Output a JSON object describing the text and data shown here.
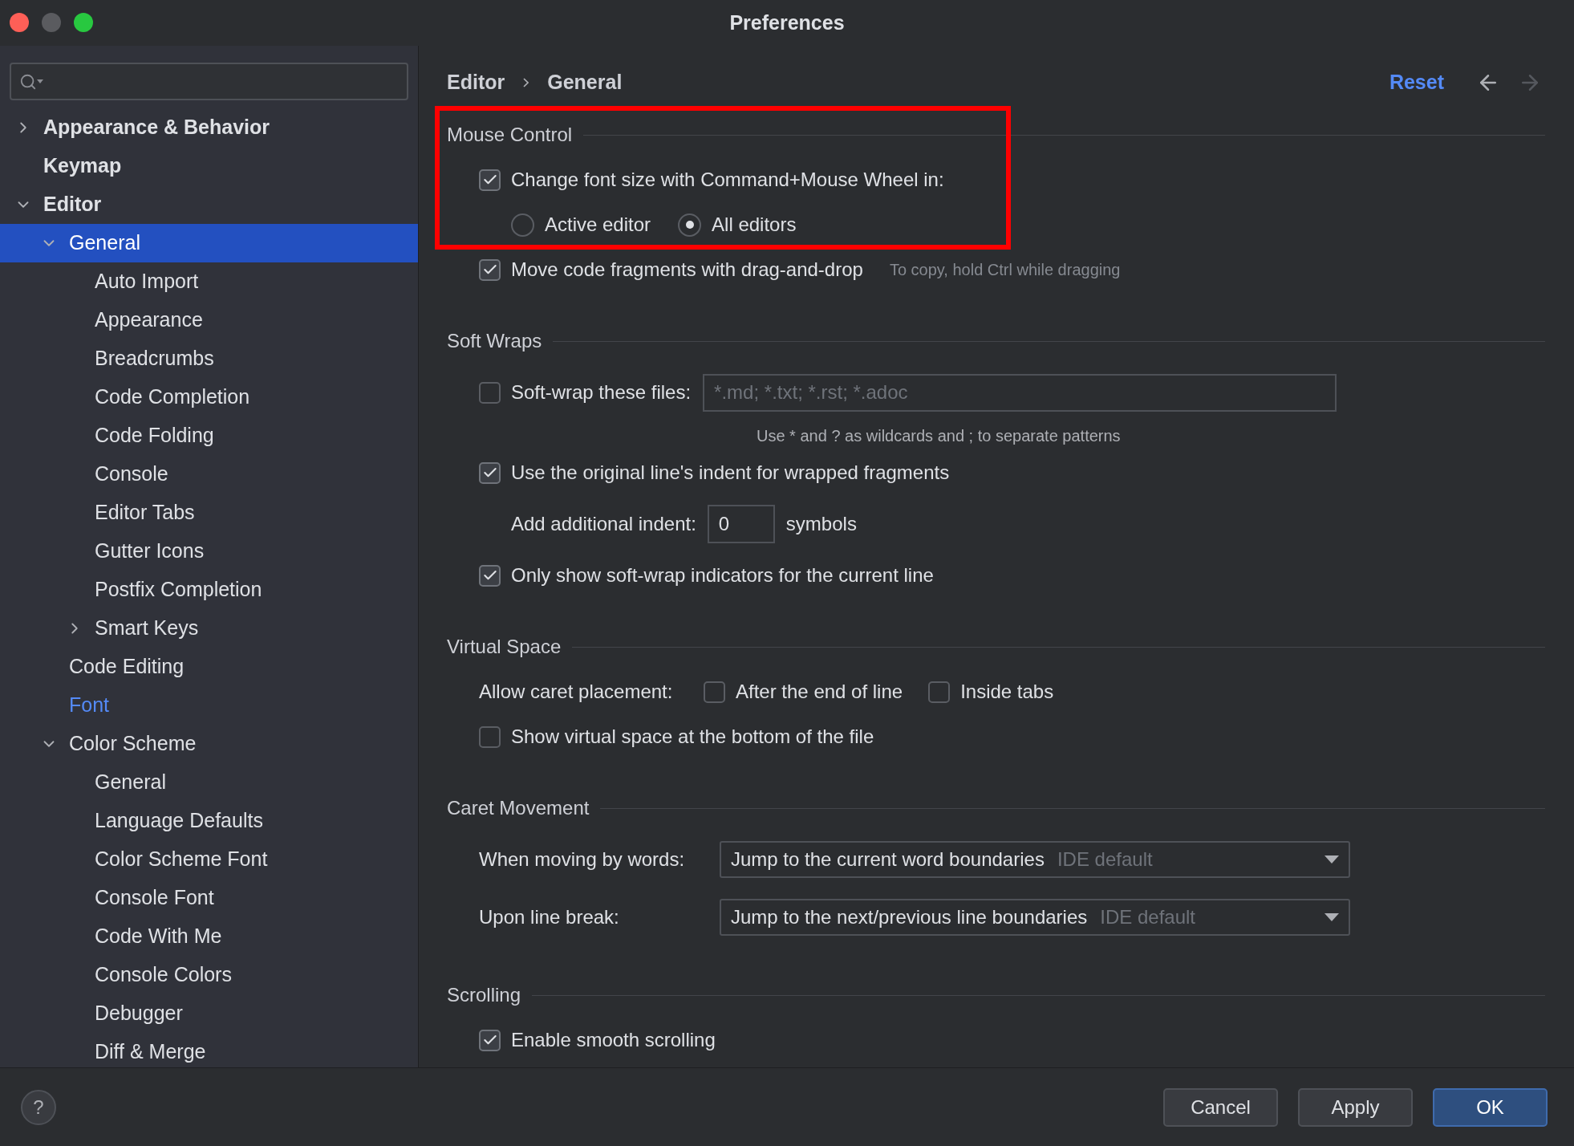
{
  "window": {
    "title": "Preferences"
  },
  "sidebar": {
    "items": [
      {
        "label": "Appearance & Behavior",
        "expanded": false,
        "selected": false,
        "modified": false
      },
      {
        "label": "Keymap",
        "selected": false,
        "modified": false
      },
      {
        "label": "Editor",
        "expanded": true,
        "selected": false,
        "modified": false,
        "children": [
          {
            "label": "General",
            "expanded": true,
            "selected": true,
            "modified": false,
            "children": [
              {
                "label": "Auto Import",
                "selected": false,
                "modified": false
              },
              {
                "label": "Appearance",
                "selected": false,
                "modified": false
              },
              {
                "label": "Breadcrumbs",
                "selected": false,
                "modified": false
              },
              {
                "label": "Code Completion",
                "selected": false,
                "modified": false
              },
              {
                "label": "Code Folding",
                "selected": false,
                "modified": false
              },
              {
                "label": "Console",
                "selected": false,
                "modified": false
              },
              {
                "label": "Editor Tabs",
                "selected": false,
                "modified": false
              },
              {
                "label": "Gutter Icons",
                "selected": false,
                "modified": false
              },
              {
                "label": "Postfix Completion",
                "selected": false,
                "modified": false
              },
              {
                "label": "Smart Keys",
                "expanded": false,
                "selected": false,
                "modified": false
              }
            ]
          },
          {
            "label": "Code Editing",
            "selected": false,
            "modified": false
          },
          {
            "label": "Font",
            "selected": false,
            "modified": true
          },
          {
            "label": "Color Scheme",
            "expanded": true,
            "selected": false,
            "modified": false,
            "children": [
              {
                "label": "General",
                "selected": false,
                "modified": false
              },
              {
                "label": "Language Defaults",
                "selected": false,
                "modified": false
              },
              {
                "label": "Color Scheme Font",
                "selected": false,
                "modified": false
              },
              {
                "label": "Console Font",
                "selected": false,
                "modified": false
              },
              {
                "label": "Code With Me",
                "selected": false,
                "modified": false
              },
              {
                "label": "Console Colors",
                "selected": false,
                "modified": false
              },
              {
                "label": "Debugger",
                "selected": false,
                "modified": false
              },
              {
                "label": "Diff & Merge",
                "selected": false,
                "modified": false
              }
            ]
          }
        ]
      }
    ]
  },
  "breadcrumb": [
    "Editor",
    "General"
  ],
  "reset": "Reset",
  "nav": {
    "back_enabled": true,
    "forward_enabled": false
  },
  "sections": [
    {
      "title": "Mouse Control",
      "highlighted": true,
      "rows": [
        {
          "kind": "checkbox",
          "label": "Change font size with Command+Mouse Wheel in:",
          "checked": true
        },
        {
          "kind": "radio_group",
          "options": [
            {
              "label": "Active editor",
              "selected": false
            },
            {
              "label": "All editors",
              "selected": true
            }
          ]
        },
        {
          "kind": "checkbox",
          "label": "Move code fragments with drag-and-drop",
          "checked": true,
          "note": "To copy, hold Ctrl while dragging"
        }
      ]
    },
    {
      "title": "Soft Wraps",
      "rows": [
        {
          "kind": "checkbox_field",
          "label": "Soft-wrap these files:",
          "checked": false,
          "placeholder": "*.md; *.txt; *.rst; *.adoc"
        },
        {
          "kind": "hint",
          "text": "Use * and ? as wildcards and ; to separate patterns"
        },
        {
          "kind": "checkbox",
          "label": "Use the original line's indent for wrapped fragments",
          "checked": true
        },
        {
          "kind": "number",
          "label": "Add additional indent:",
          "value": "0",
          "unit": "symbols"
        },
        {
          "kind": "checkbox",
          "label": "Only show soft-wrap indicators for the current line",
          "checked": true
        }
      ]
    },
    {
      "title": "Virtual Space",
      "rows": [
        {
          "kind": "inline_checks",
          "label": "Allow caret placement:",
          "options": [
            {
              "label": "After the end of line",
              "checked": false
            },
            {
              "label": "Inside tabs",
              "checked": false
            }
          ]
        },
        {
          "kind": "checkbox",
          "label": "Show virtual space at the bottom of the file",
          "checked": false
        }
      ]
    },
    {
      "title": "Caret Movement",
      "rows": [
        {
          "kind": "dropdown",
          "label": "When moving by words:",
          "value": "Jump to the current word boundaries",
          "note": "IDE default"
        },
        {
          "kind": "dropdown",
          "label": "Upon line break:",
          "value": "Jump to the next/previous line boundaries",
          "note": "IDE default"
        }
      ]
    },
    {
      "title": "Scrolling",
      "rows": [
        {
          "kind": "checkbox",
          "label": "Enable smooth scrolling",
          "checked": true
        }
      ]
    }
  ],
  "footer": {
    "help": "?",
    "buttons": [
      {
        "label": "Cancel",
        "primary": false
      },
      {
        "label": "Apply",
        "primary": false
      },
      {
        "label": "OK",
        "primary": true
      }
    ]
  }
}
